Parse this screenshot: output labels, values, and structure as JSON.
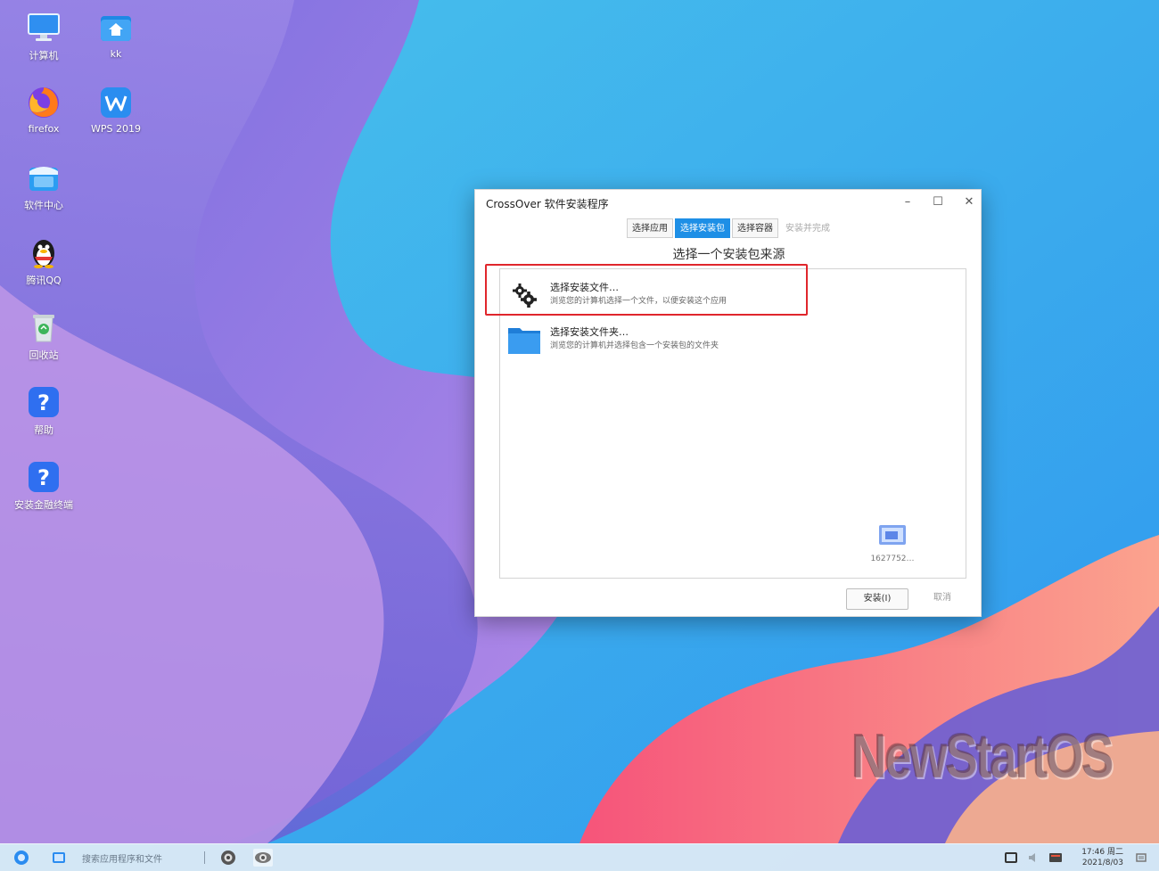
{
  "desktop": {
    "icons": [
      {
        "label": "计算机",
        "icon": "monitor-icon"
      },
      {
        "label": "kk",
        "icon": "home-folder-icon"
      },
      {
        "label": "firefox",
        "icon": "firefox-icon"
      },
      {
        "label": "WPS 2019",
        "icon": "wps-icon"
      },
      {
        "label": "软件中心",
        "icon": "software-center-icon"
      },
      {
        "label": "腾讯QQ",
        "icon": "qq-penguin-icon"
      },
      {
        "label": "回收站",
        "icon": "recycle-bin-icon"
      },
      {
        "label": "帮助",
        "icon": "help-icon"
      },
      {
        "label": "安装金融终端",
        "icon": "help-icon"
      }
    ],
    "watermark": "NewStartOS"
  },
  "dialog": {
    "title": "CrossOver 软件安装程序",
    "controls": {
      "minimize": "–",
      "maximize": "☐",
      "close": "✕"
    },
    "steps": [
      {
        "label": "选择应用",
        "state": "normal"
      },
      {
        "label": "选择安装包",
        "state": "active"
      },
      {
        "label": "选择容器",
        "state": "normal"
      },
      {
        "label": "安装并完成",
        "state": "disabled"
      }
    ],
    "heading": "选择一个安装包来源",
    "options": [
      {
        "title": "选择安装文件…",
        "desc": "浏览您的计算机选择一个文件，以便安装这个应用",
        "icon": "gear-icon"
      },
      {
        "title": "选择安装文件夹…",
        "desc": "浏览您的计算机并选择包含一个安装包的文件夹",
        "icon": "folder-icon"
      }
    ],
    "selected_file": "1627752…",
    "install_button": "安装(I)",
    "cancel_button": "取消"
  },
  "taskbar": {
    "search_placeholder": "搜索应用程序和文件",
    "clock_time": "17:46 周二",
    "clock_date": "2021/8/03"
  },
  "colors": {
    "accent": "#1e8fe6",
    "highlight": "#e0262c"
  }
}
